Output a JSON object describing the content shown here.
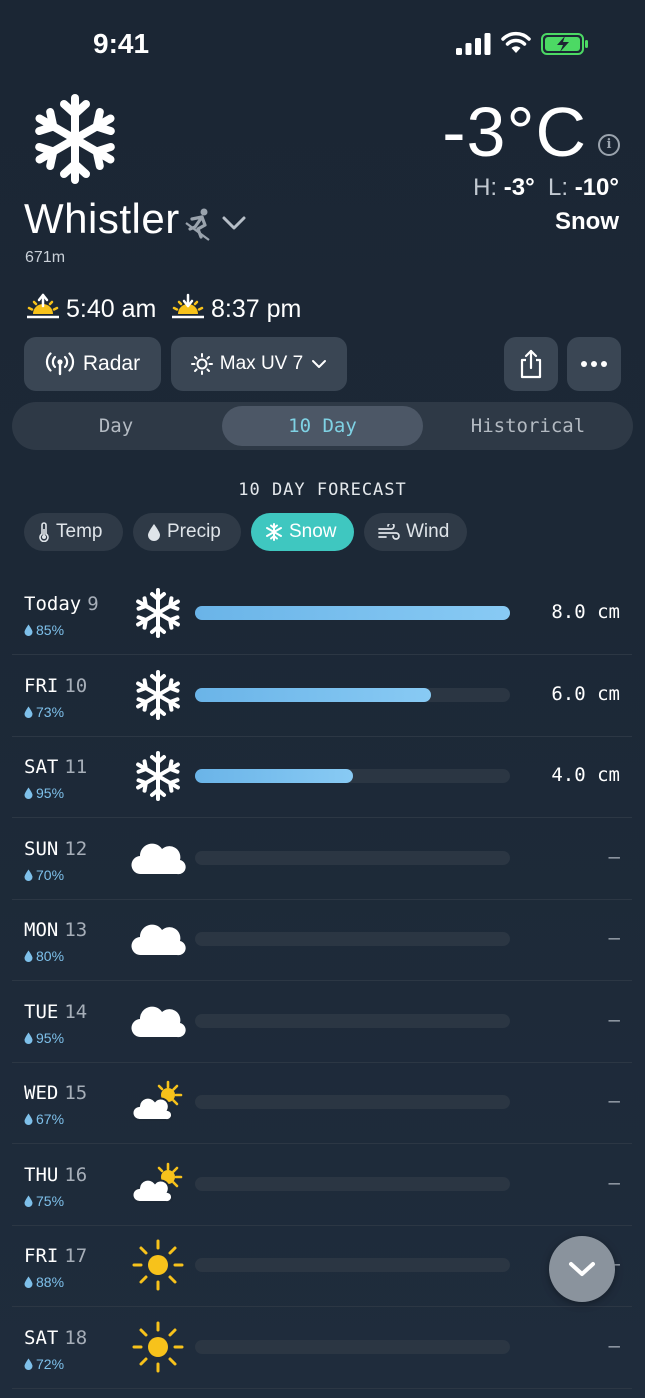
{
  "status_bar": {
    "time": "9:41"
  },
  "location": {
    "name": "Whistler",
    "elevation": "671m"
  },
  "current": {
    "temp": "-3°C",
    "high_label": "H:",
    "high": "-3°",
    "low_label": "L:",
    "low": "-10°",
    "condition": "Snow"
  },
  "sun": {
    "sunrise": "5:40 am",
    "sunset": "8:37 pm"
  },
  "actions": {
    "radar_label": "Radar",
    "uv_label": "Max UV 7"
  },
  "segments": {
    "day": "Day",
    "ten_day": "10 Day",
    "historical": "Historical",
    "selected": "10 Day"
  },
  "forecast": {
    "title": "10 DAY FORECAST",
    "chips": {
      "temp": "Temp",
      "precip": "Precip",
      "snow": "Snow",
      "wind": "Wind",
      "selected": "Snow"
    },
    "max_cm": 8.0,
    "days": [
      {
        "day": "Today",
        "date": "9",
        "precip": "85%",
        "icon": "snowflake-icon",
        "snow_cm": 8.0,
        "amount": "8.0 cm"
      },
      {
        "day": "FRI",
        "date": "10",
        "precip": "73%",
        "icon": "snowflake-icon",
        "snow_cm": 6.0,
        "amount": "6.0 cm"
      },
      {
        "day": "SAT",
        "date": "11",
        "precip": "95%",
        "icon": "snowflake-icon",
        "snow_cm": 4.0,
        "amount": "4.0 cm"
      },
      {
        "day": "SUN",
        "date": "12",
        "precip": "70%",
        "icon": "cloud-icon",
        "snow_cm": 0,
        "amount": "–"
      },
      {
        "day": "MON",
        "date": "13",
        "precip": "80%",
        "icon": "cloud-icon",
        "snow_cm": 0,
        "amount": "–"
      },
      {
        "day": "TUE",
        "date": "14",
        "precip": "95%",
        "icon": "cloud-icon",
        "snow_cm": 0,
        "amount": "–"
      },
      {
        "day": "WED",
        "date": "15",
        "precip": "67%",
        "icon": "partly-sunny-icon",
        "snow_cm": 0,
        "amount": "–"
      },
      {
        "day": "THU",
        "date": "16",
        "precip": "75%",
        "icon": "partly-sunny-icon",
        "snow_cm": 0,
        "amount": "–"
      },
      {
        "day": "FRI",
        "date": "17",
        "precip": "88%",
        "icon": "sun-icon",
        "snow_cm": 0,
        "amount": "–"
      },
      {
        "day": "SAT",
        "date": "18",
        "precip": "72%",
        "icon": "sun-icon",
        "snow_cm": 0,
        "amount": "–"
      }
    ]
  },
  "colors": {
    "accent": "#3fc7c0",
    "bar": "#7cc1f0",
    "precip_text": "#7ec0ea",
    "sun": "#f7c21b"
  }
}
